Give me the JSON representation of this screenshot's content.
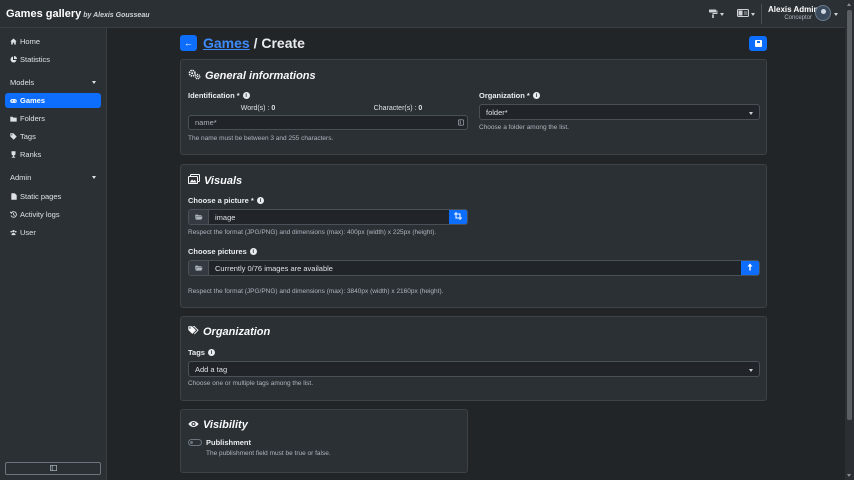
{
  "app": {
    "title": "Games gallery",
    "author": "by Alexis Gousseau"
  },
  "user": {
    "name": "Alexis Admin",
    "role": "Conceptor"
  },
  "sidebar": {
    "items": [
      {
        "label": "Home",
        "icon": "home-icon"
      },
      {
        "label": "Statistics",
        "icon": "statistics-icon"
      }
    ],
    "models_header": "Models",
    "models": [
      {
        "label": "Games",
        "icon": "gamepad-icon",
        "active": true
      },
      {
        "label": "Folders",
        "icon": "folder-icon"
      },
      {
        "label": "Tags",
        "icon": "tag-icon"
      },
      {
        "label": "Ranks",
        "icon": "trophy-icon"
      }
    ],
    "admin_header": "Admin",
    "admin": [
      {
        "label": "Static pages",
        "icon": "file-icon"
      },
      {
        "label": "Activity logs",
        "icon": "history-icon"
      },
      {
        "label": "User",
        "icon": "users-icon"
      }
    ]
  },
  "page": {
    "breadcrumb_link": "Games",
    "separator": " / ",
    "current": "Create"
  },
  "general": {
    "title": "General informations",
    "identification_label": "Identification *",
    "words_label": "Word(s) : ",
    "words_count": "0",
    "chars_label": "Character(s) : ",
    "chars_count": "0",
    "name_placeholder": "name*",
    "name_help": "The name must be between 3 and 255 characters.",
    "organization_label": "Organization *",
    "folder_placeholder": "folder*",
    "folder_help": "Choose a folder among the list."
  },
  "visuals": {
    "title": "Visuals",
    "picture_label": "Choose a picture *",
    "picture_value": "image",
    "picture_help": "Respect the format (JPG/PNG) and dimensions (max): 400px (width) x 225px (height).",
    "pictures_label": "Choose pictures",
    "pictures_value": "Currently 0/76 images are available",
    "pictures_help": "Respect the format (JPG/PNG) and dimensions (max): 3840px (width) x 2160px (height)."
  },
  "organization": {
    "title": "Organization",
    "tags_label": "Tags",
    "tags_placeholder": "Add a tag",
    "tags_help": "Choose one or multiple tags among the list."
  },
  "visibility": {
    "title": "Visibility",
    "publish_label": "Publishment",
    "publish_help": "The publishment field must be true or false.",
    "published": false
  },
  "colors": {
    "primary": "#0d6efd",
    "link": "#3d8bfd",
    "background": "#222528",
    "card": "#2b3035"
  }
}
